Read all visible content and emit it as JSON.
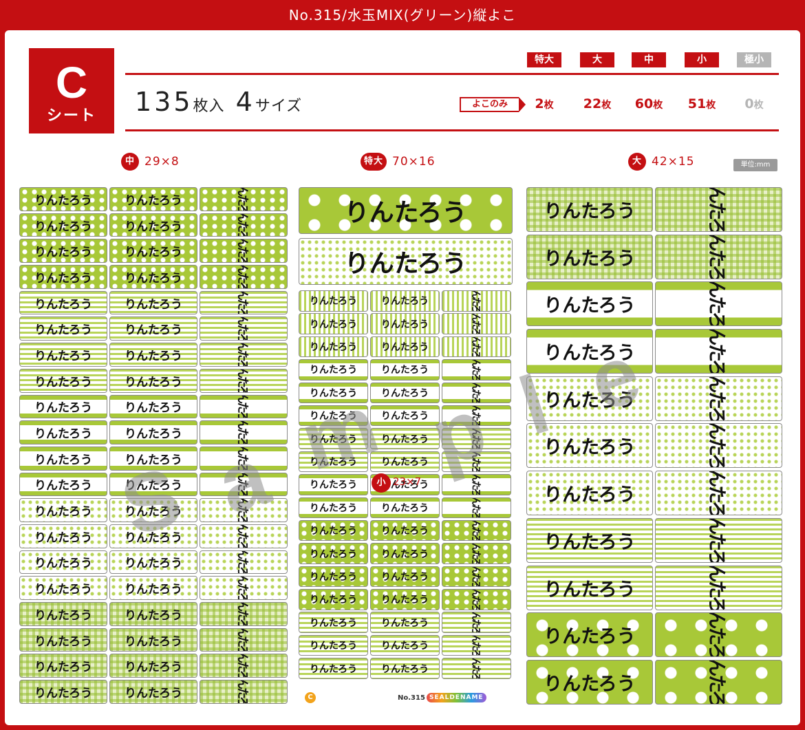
{
  "header": {
    "title": "No.315/水玉MIX(グリーン)縦よこ"
  },
  "sheet": {
    "letter": "C",
    "word": "シート"
  },
  "summary": {
    "count": "135",
    "count_unit": "枚入",
    "sizes": "4",
    "sizes_unit": "サイズ"
  },
  "yoko_only": "よこのみ",
  "size_tags": [
    {
      "label": "特大",
      "count": "2",
      "unit": "枚",
      "enabled": true
    },
    {
      "label": "大",
      "count": "22",
      "unit": "枚",
      "enabled": true
    },
    {
      "label": "中",
      "count": "60",
      "unit": "枚",
      "enabled": true
    },
    {
      "label": "小",
      "count": "51",
      "unit": "枚",
      "enabled": true
    },
    {
      "label": "極小",
      "count": "0",
      "unit": "枚",
      "enabled": false
    }
  ],
  "columns": {
    "left": {
      "size": "中",
      "dims": "29×8"
    },
    "center": {
      "size": "特大",
      "dims": "70×16"
    },
    "right": {
      "size": "大",
      "dims": "42×15"
    },
    "small": {
      "size": "小",
      "dims": "23×7"
    }
  },
  "unit_label": "単位:mm",
  "label_text": "りんたろう",
  "watermark": [
    "S",
    "a",
    "m",
    "p",
    "l",
    "e"
  ],
  "footer": {
    "mark": "C",
    "number": "No.315",
    "brand": "SEALDENAME"
  },
  "colors": {
    "brand_red": "#c40f12",
    "accent_green": "#a8c838"
  }
}
